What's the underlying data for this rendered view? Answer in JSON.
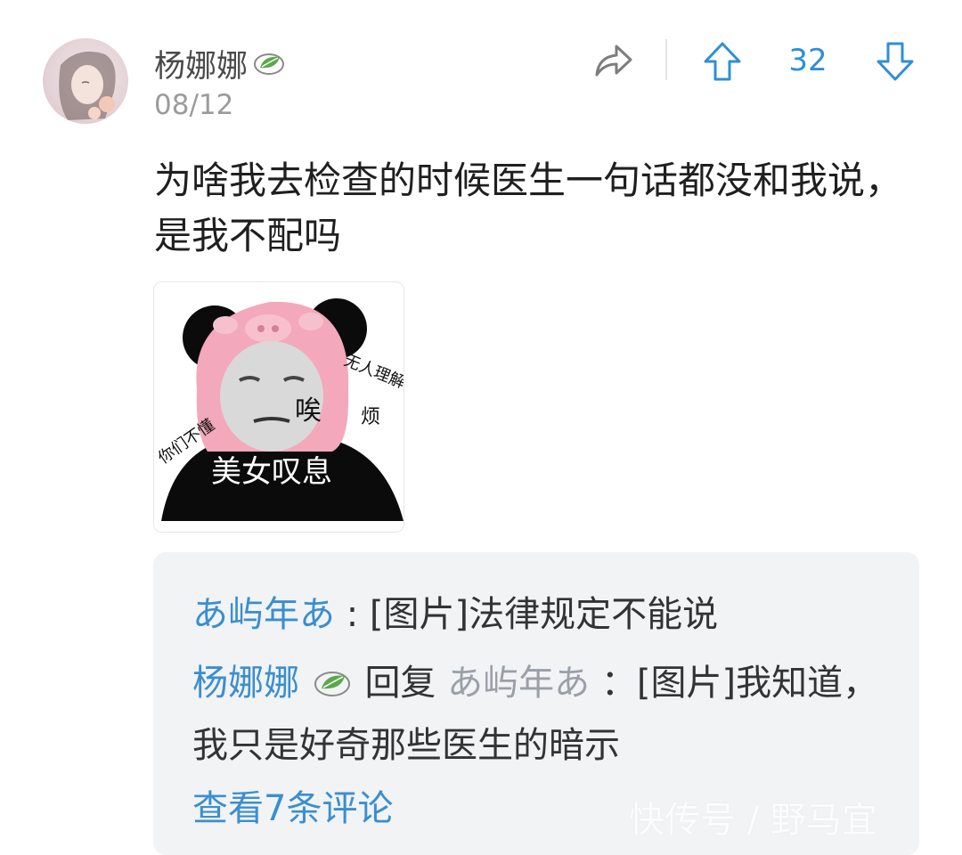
{
  "post": {
    "username": "杨娜娜",
    "date": "08/12",
    "vote_count": "32",
    "text": "为啥我去检查的时候医生一句话都没和我说，是我不配吗",
    "image": {
      "texts": [
        "无人理解",
        "唉",
        "烦",
        "你们不懂",
        "美女叹息"
      ]
    }
  },
  "comments": {
    "items": [
      {
        "author": "あ屿年あ",
        "separator": ":",
        "content": "[图片]法律规定不能说"
      },
      {
        "author": "杨娜娜",
        "reply_word": "回复",
        "reply_to": "あ屿年あ",
        "separator": "：",
        "content": "[图片]我知道，我只是好奇那些医生的暗示"
      }
    ],
    "view_more": "查看7条评论"
  },
  "watermark": "快传号 / 野马宜",
  "colors": {
    "accent": "#2e8fd8",
    "link": "#3a8ed0",
    "muted": "#9b9b9b",
    "comment_bg": "#f2f3f5",
    "leaf": "#5aa84a"
  },
  "icons": [
    "avatar",
    "leaf-badge-icon",
    "share-icon",
    "upvote-icon",
    "downvote-icon"
  ]
}
